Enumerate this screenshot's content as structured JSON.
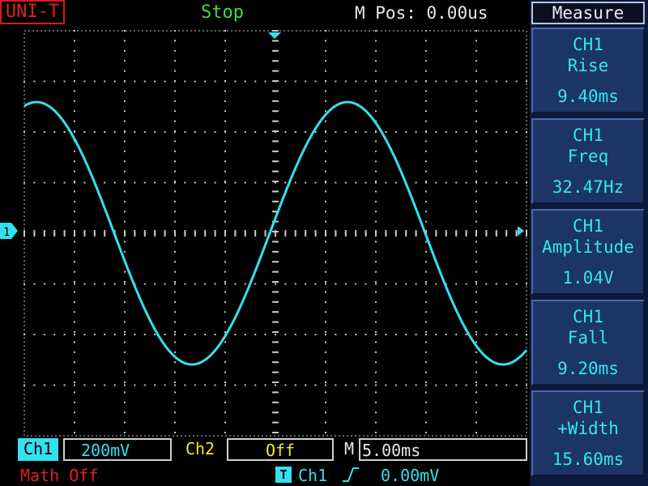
{
  "header": {
    "brand": "UNI-T",
    "run_state": "Stop",
    "mpos_label": "M Pos:",
    "mpos_value": "0.00us"
  },
  "plot": {
    "channel_marker": "1",
    "trace_color": "#35e0ee",
    "grid_color": "#c8c8c8"
  },
  "measure": {
    "header": "Measure",
    "items": [
      {
        "channel": "CH1",
        "name": "Rise",
        "value": "9.40ms"
      },
      {
        "channel": "CH1",
        "name": "Freq",
        "value": "32.47Hz"
      },
      {
        "channel": "CH1",
        "name": "Amplitude",
        "value": "1.04V"
      },
      {
        "channel": "CH1",
        "name": "Fall",
        "value": "9.20ms"
      },
      {
        "channel": "CH1",
        "name": "+Width",
        "value": "15.60ms"
      }
    ]
  },
  "status": {
    "ch1_label": "Ch1",
    "ch1_scale": "200mV",
    "ch2_label": "Ch2",
    "ch2_scale": "Off",
    "time_label": "M",
    "time_scale": "5.00ms",
    "math": "Math Off",
    "trigger_icon": "T",
    "trigger_source": "Ch1",
    "trigger_level": "0.00mV"
  },
  "colors": {
    "ch1": "#35e0ee",
    "ch2": "#f0ea2a",
    "run_state": "#3ddc3d",
    "brand": "#e02020",
    "panel": "#1b3567"
  }
}
